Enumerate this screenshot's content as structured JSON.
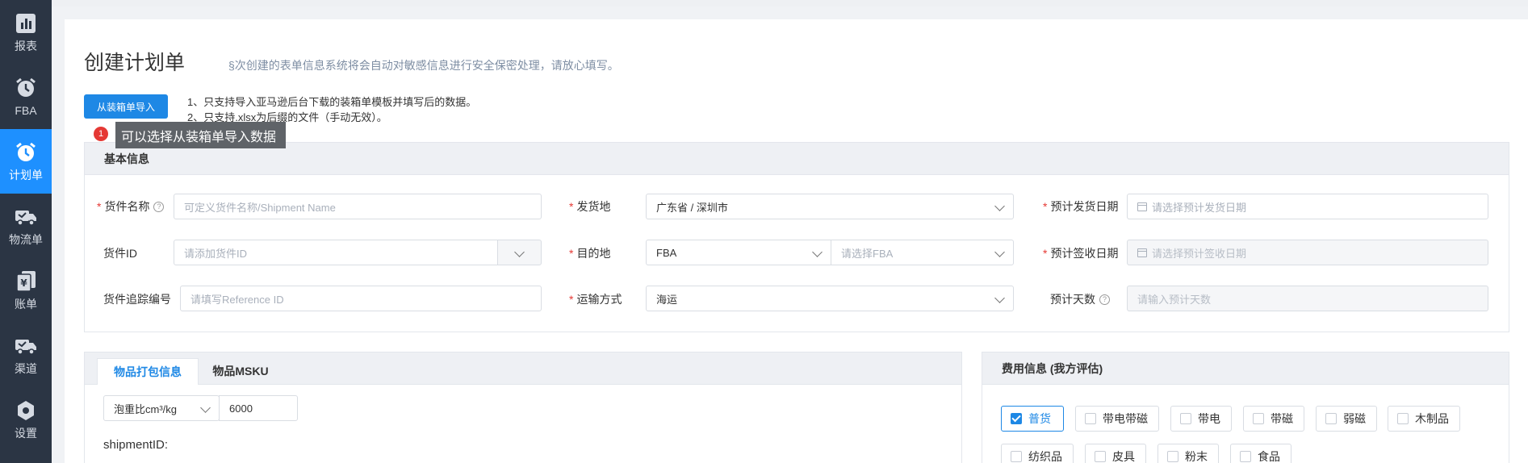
{
  "sidebar": {
    "items": [
      {
        "label": "报表",
        "icon": "bar-chart-icon"
      },
      {
        "label": "FBA",
        "icon": "alarm-clock-icon"
      },
      {
        "label": "计划单",
        "icon": "alarm-clock-icon",
        "active": true
      },
      {
        "label": "物流单",
        "icon": "truck-icon"
      },
      {
        "label": "账单",
        "icon": "bill-icon"
      },
      {
        "label": "渠道",
        "icon": "truck-icon"
      },
      {
        "label": "设置",
        "icon": "gear-icon"
      }
    ]
  },
  "page": {
    "title": "创建计划单",
    "notice": "§次创建的表单信息系统将会自动对敏感信息进行安全保密处理，请放心填写。"
  },
  "import": {
    "button_label": "从装箱单导入",
    "note1": "1、只支持导入亚马逊后台下载的装箱单模板并填写后的数据。",
    "note2": "2、只支持.xlsx为后缀的文件（手动无效）。",
    "tooltip_badge": "1",
    "tooltip_text": "可以选择从装箱单导入数据"
  },
  "basic": {
    "title": "基本信息",
    "shipment_name": {
      "label": "货件名称",
      "placeholder": "可定义货件名称/Shipment Name"
    },
    "shipment_id": {
      "label": "货件ID",
      "placeholder": "请添加货件ID"
    },
    "tracking_no": {
      "label": "货件追踪编号",
      "placeholder": "请填写Reference ID"
    },
    "origin": {
      "label": "发货地",
      "value": "广东省 / 深圳市"
    },
    "destination": {
      "label": "目的地",
      "value": "FBA",
      "sub_placeholder": "请选择FBA"
    },
    "transport": {
      "label": "运输方式",
      "value": "海运"
    },
    "ship_date": {
      "label": "预计发货日期",
      "placeholder": "请选择预计发货日期"
    },
    "receive_date": {
      "label": "预计签收日期",
      "placeholder": "请选择预计签收日期"
    },
    "est_days": {
      "label": "预计天数",
      "placeholder": "请输入预计天数"
    }
  },
  "packing": {
    "tabs": [
      "物品打包信息",
      "物品MSKU"
    ],
    "ratio_label": "泡重比cm³/kg",
    "ratio_value": "6000",
    "shipment_id_label": "shipmentID:"
  },
  "fees": {
    "title": "费用信息 (我方评估)",
    "options": [
      {
        "label": "普货",
        "checked": true
      },
      {
        "label": "带电带磁",
        "checked": false
      },
      {
        "label": "带电",
        "checked": false
      },
      {
        "label": "带磁",
        "checked": false
      },
      {
        "label": "弱磁",
        "checked": false
      },
      {
        "label": "木制品",
        "checked": false
      },
      {
        "label": "纺织品",
        "checked": false
      },
      {
        "label": "皮具",
        "checked": false
      },
      {
        "label": "粉末",
        "checked": false
      },
      {
        "label": "食品",
        "checked": false
      }
    ]
  },
  "colors": {
    "sidebar": "#2b3544",
    "accent": "#1e88e5",
    "required": "#e53935"
  }
}
